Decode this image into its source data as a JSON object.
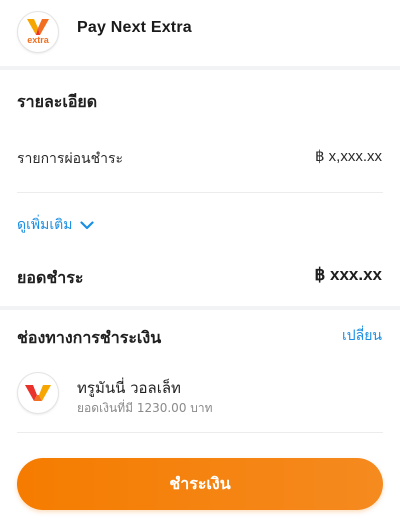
{
  "header": {
    "logo_text": "extra",
    "title": "Pay Next Extra"
  },
  "details": {
    "section_title": "รายละเอียด",
    "item_label": "รายการผ่อนชำระ",
    "item_value": "฿ x,xxx.xx",
    "more_label": "ดูเพิ่มเติม",
    "total_label": "ยอดชำระ",
    "total_value": "฿ xxx.xx"
  },
  "payment_method": {
    "section_title": "ช่องทางการชำระเงิน",
    "change_label": "เปลี่ยน",
    "wallet_name": "ทรูมันนี่ วอลเล็ท",
    "wallet_balance": "ยอดเงินที่มี 1230.00 บาท"
  },
  "action": {
    "pay_label": "ชำระเงิน"
  },
  "colors": {
    "accent": "#f57c00",
    "link": "#1a8fe3",
    "logo_red": "#e8322b",
    "logo_orange": "#f7a600"
  }
}
